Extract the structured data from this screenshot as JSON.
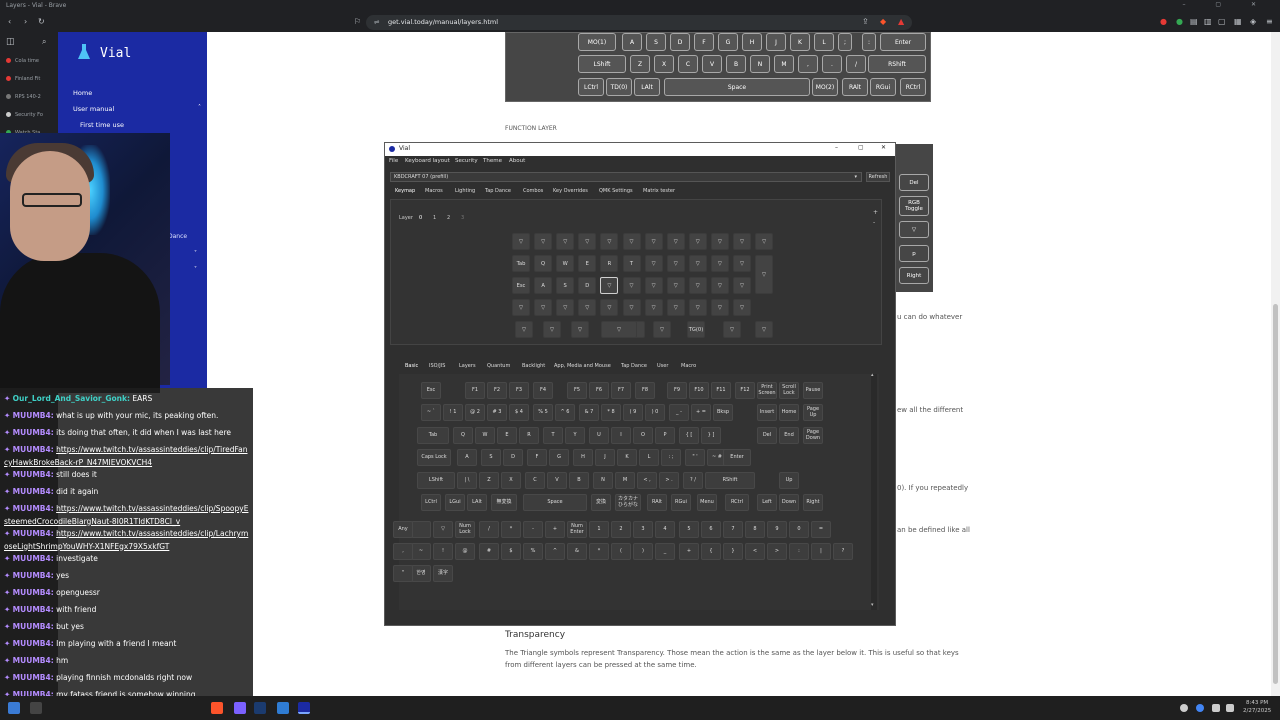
{
  "browser": {
    "window_title": "Layers - Vial - Brave",
    "url": "get.vial.today/manual/layers.html"
  },
  "side_panel": {
    "items": [
      "Cola time",
      "Finland Fit",
      "RPS 140-2",
      "Security Fo",
      "Watch Sta"
    ]
  },
  "vial_nav": {
    "brand": "Vial",
    "home": "Home",
    "user_manual": "User manual",
    "first_time_use": "First time use",
    "tap_dance": "Dance"
  },
  "chat": [
    {
      "user": "Our_Lord_And_Savior_Gonk:",
      "text": "EARS",
      "style": "gonk"
    },
    {
      "user": "MUUMB4:",
      "text": "what is up with your mic, its peaking often."
    },
    {
      "user": "MUUMB4:",
      "text": "its doing that often, it did when I was last here"
    },
    {
      "user": "MUUMB4:",
      "link": "https://www.twitch.tv/assassinteddies/clip/TiredFancyHawkBrokeBack-rP_N47MIEVOKVCH4"
    },
    {
      "user": "MUUMB4:",
      "text": "still does it"
    },
    {
      "user": "MUUMB4:",
      "text": "did it again"
    },
    {
      "user": "MUUMB4:",
      "link": "https://www.twitch.tv/assassinteddies/clip/SpoopyEsteemedCrocodileBlargNaut-8I0R1TIdKTD8Cl_v"
    },
    {
      "user": "MUUMB4:",
      "link": "https://www.twitch.tv/assassinteddies/clip/LachrymoseLightShrimpYouWHY-X1NFEgx79X5xkfGT"
    },
    {
      "user": "MUUMB4:",
      "text": "investigate"
    },
    {
      "user": "MUUMB4:",
      "text": "yes"
    },
    {
      "user": "MUUMB4:",
      "text": "openguessr"
    },
    {
      "user": "MUUMB4:",
      "text": "with friend"
    },
    {
      "user": "MUUMB4:",
      "text": "but yes"
    },
    {
      "user": "MUUMB4:",
      "text": "Im playing with a friend I meant"
    },
    {
      "user": "MUUMB4:",
      "text": "hm"
    },
    {
      "user": "MUUMB4:",
      "text": "playing finnish mcdonalds right now"
    },
    {
      "user": "MUUMB4:",
      "text": "my fatass friend is somehow winning"
    }
  ],
  "page": {
    "top_keyboard": {
      "row1": [
        "MO(1)",
        "A",
        "S",
        "D",
        "F",
        "G",
        "H",
        "J",
        "K",
        "L",
        ";",
        ":",
        "Enter"
      ],
      "row2": [
        "LShift",
        "Z",
        "X",
        "C",
        "V",
        "B",
        "N",
        "M",
        ",",
        "<",
        ".",
        ">",
        "/",
        "?",
        "RShift"
      ],
      "row3": [
        "LCtrl",
        "TD(0)",
        "LAlt",
        "Space",
        "MO(2)",
        "RAlt",
        "RGui",
        "RCtrl"
      ]
    },
    "function_layer_heading": "FUNCTION LAYER",
    "right_snippets": [
      "u can do whatever",
      "ew all the different",
      "0). If you repeatedly",
      "an be defined like all"
    ],
    "transparency_heading": "Transparency",
    "transparency_text": "The Triangle symbols represent Transparency. Those mean the action is the same as the layer below it. This is useful so that keys from different layers can be pressed at the same time."
  },
  "behind_window_keys": [
    "Del",
    "RGB Toggle",
    "▽",
    "p",
    "Right"
  ],
  "vial_app": {
    "title": "Vial",
    "menu": [
      "File",
      "Keyboard layout",
      "Security",
      "Theme",
      "About"
    ],
    "keyboard_select": "KBDCRAFT 07 (prefill)",
    "refresh": "Refresh",
    "tabs": [
      "Keymap",
      "Macros",
      "Lighting",
      "Tap Dance",
      "Combos",
      "Key Overrides",
      "QMK Settings",
      "Matrix tester"
    ],
    "layer_label": "Layer",
    "layers": [
      "0",
      "1",
      "2",
      "3"
    ],
    "keymap_rows": [
      [
        "▽",
        "▽",
        "▽",
        "▽",
        "▽",
        "▽",
        "▽",
        "▽",
        "▽",
        "▽",
        "▽",
        "▽"
      ],
      [
        "Tab",
        "Q",
        "W",
        "E",
        "R",
        "T",
        "▽",
        "▽",
        "▽",
        "▽",
        "▽"
      ],
      [
        "Esc",
        "A",
        "S",
        "D",
        "▽",
        "▽",
        "▽",
        "▽",
        "▽",
        "▽",
        "▽"
      ],
      [
        "▽",
        "▽",
        "▽",
        "▽",
        "▽",
        "▽",
        "▽",
        "▽",
        "▽",
        "▽",
        "▽"
      ],
      [
        "▽",
        "▽",
        "▽",
        "▽",
        "▽",
        "TG(0)",
        "▽",
        "▽"
      ]
    ],
    "picker_tabs": [
      "Basic",
      "ISO/JIS",
      "Layers",
      "Quantum",
      "Backlight",
      "App, Media and Mouse",
      "Tap Dance",
      "User",
      "Macro"
    ],
    "picker_rows": [
      [
        "Esc",
        "F1",
        "F2",
        "F3",
        "F4",
        "F5",
        "F6",
        "F7",
        "F8",
        "F9",
        "F10",
        "F11",
        "F12",
        "Print Screen",
        "Scroll Lock",
        "Pause"
      ],
      [
        "~ `",
        "! 1",
        "@ 2",
        "# 3",
        "$ 4",
        "% 5",
        "^ 6",
        "& 7",
        "* 8",
        "( 9",
        ") 0",
        "_ -",
        "+ =",
        "Bksp",
        "Insert",
        "Home",
        "Page Up"
      ],
      [
        "Tab",
        "Q",
        "W",
        "E",
        "R",
        "T",
        "Y",
        "U",
        "I",
        "O",
        "P",
        "{ [",
        "} ]",
        "Del",
        "End",
        "Page Down"
      ],
      [
        "Caps Lock",
        "A",
        "S",
        "D",
        "F",
        "G",
        "H",
        "J",
        "K",
        "L",
        ": ;",
        "\" '",
        "~ #",
        "Enter"
      ],
      [
        "LShift",
        "| \\",
        "Z",
        "X",
        "C",
        "V",
        "B",
        "N",
        "M",
        "< ,",
        "> .",
        "? /",
        "RShift",
        "Up"
      ],
      [
        "LCtrl",
        "LGui",
        "LAlt",
        "無変換",
        "Space",
        "変換",
        "カタカナ ひらがな",
        "RAlt",
        "RGui",
        "Menu",
        "RCtrl",
        "Left",
        "Down",
        "Right"
      ],
      [
        "Any",
        "",
        "▽",
        "Num Lock",
        "/",
        "*",
        "-",
        "+",
        "Num Enter",
        "1",
        "2",
        "3",
        "4",
        "5",
        "6",
        "7",
        "8",
        "9",
        "0",
        "="
      ],
      [
        ",",
        "~",
        "!",
        "@",
        "#",
        "$",
        "%",
        "^",
        "&",
        "*",
        "(",
        ")",
        "_",
        "+",
        "{",
        "}",
        "<",
        ">",
        ":",
        "|",
        "?"
      ],
      [
        "\"",
        "한영",
        "漢字"
      ]
    ]
  },
  "taskbar": {
    "time": "8:43 PM",
    "date": "2/27/2025"
  }
}
